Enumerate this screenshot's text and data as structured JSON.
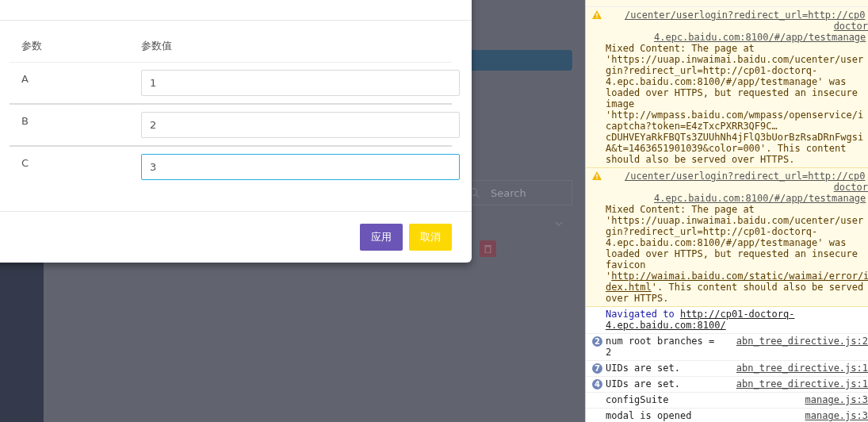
{
  "background": {
    "search": {
      "placeholder": "Search"
    }
  },
  "modal": {
    "columns": [
      "参数",
      "参数值"
    ],
    "rows": [
      {
        "name": "A",
        "value": "1",
        "focused": false
      },
      {
        "name": "B",
        "value": "2",
        "focused": false
      },
      {
        "name": "C",
        "value": "3",
        "focused": true
      }
    ],
    "buttons": [
      {
        "label": "应用",
        "kind": "primary"
      },
      {
        "label": "取消",
        "kind": "warning"
      }
    ]
  },
  "console": {
    "messages": [
      {
        "kind": "warning",
        "url_lines": [
          "/ucenter/userlogin?redirect_url=http://cp0",
          "doctor",
          "4.epc.baidu.com:8100/#/app/testmanage"
        ],
        "lines": [
          [
            {
              "text": "Mixed Content: The page at"
            }
          ],
          [
            {
              "text": "'https://uuap.inwaimai.baidu.com/ucenter/user"
            }
          ],
          [
            {
              "text": "gin?redirect_url=http://cp01-doctorq-"
            }
          ],
          [
            {
              "text": "4.epc.baidu.com:8100/#/app/testmanage' was"
            }
          ],
          [
            {
              "text": "loaded over HTTPS, but requested an insecure"
            }
          ],
          [
            {
              "text": "image"
            }
          ],
          [
            {
              "text": "'http://wmpass.baidu.com/wmpass/openservice/i"
            }
          ],
          [
            {
              "text": "captcha?token=E4zTxcPXRR3QF9C…"
            }
          ],
          [
            {
              "text": "cDUHVEYaRkFBQTs3ZUUhNh4jFlQ3bUorBzRsaDRnFwgsi"
            }
          ],
          [
            {
              "text": "A&t=1463651901039&color=000'. This content"
            }
          ],
          [
            {
              "text": "should also be served over HTTPS."
            }
          ]
        ]
      },
      {
        "kind": "warning",
        "url_lines": [
          "/ucenter/userlogin?redirect_url=http://cp0",
          "doctor",
          "4.epc.baidu.com:8100/#/app/testmanage"
        ],
        "lines": [
          [
            {
              "text": "Mixed Content: The page at"
            }
          ],
          [
            {
              "text": "'https://uuap.inwaimai.baidu.com/ucenter/user"
            }
          ],
          [
            {
              "text": "gin?redirect_url=http://cp01-doctorq-"
            }
          ],
          [
            {
              "text": "4.epc.baidu.com:8100/#/app/testmanage' was"
            }
          ],
          [
            {
              "text": "loaded over HTTPS, but requested an insecure"
            }
          ],
          [
            {
              "text": "favicon"
            }
          ],
          [
            {
              "text": "'"
            },
            {
              "text": "http://waimai.baidu.com/static/waimai/error/i",
              "link": true
            }
          ],
          [
            {
              "text": "dex.html",
              "link": true
            },
            {
              "text": "'. This content should also be served"
            }
          ],
          [
            {
              "text": "over HTTPS."
            }
          ]
        ]
      },
      {
        "kind": "navigation",
        "lines": [
          [
            {
              "text": "Navigated to ",
              "nav": true
            },
            {
              "text": "http://cp01-doctorq-",
              "link": true
            }
          ],
          [
            {
              "text": "4.epc.baidu.com:8100/",
              "link": true
            }
          ]
        ]
      },
      {
        "kind": "log",
        "count": "2",
        "source": "abn_tree_directive.js:2",
        "lines": [
          [
            {
              "text": "num root branches ="
            }
          ],
          [
            {
              "text": "2"
            }
          ]
        ]
      },
      {
        "kind": "log",
        "count": "7",
        "source": "abn_tree_directive.js:1",
        "lines": [
          [
            {
              "text": "UIDs are set."
            }
          ]
        ]
      },
      {
        "kind": "log",
        "count": "4",
        "source": "abn_tree_directive.js:1",
        "lines": [
          [
            {
              "text": "UIDs are set."
            }
          ]
        ]
      },
      {
        "kind": "log",
        "source": "manage.js:3",
        "lines": [
          [
            {
              "text": "configSuite"
            }
          ]
        ]
      },
      {
        "kind": "log",
        "source": "manage.js:3",
        "lines": [
          [
            {
              "text": "modal is opened"
            }
          ]
        ]
      }
    ]
  }
}
